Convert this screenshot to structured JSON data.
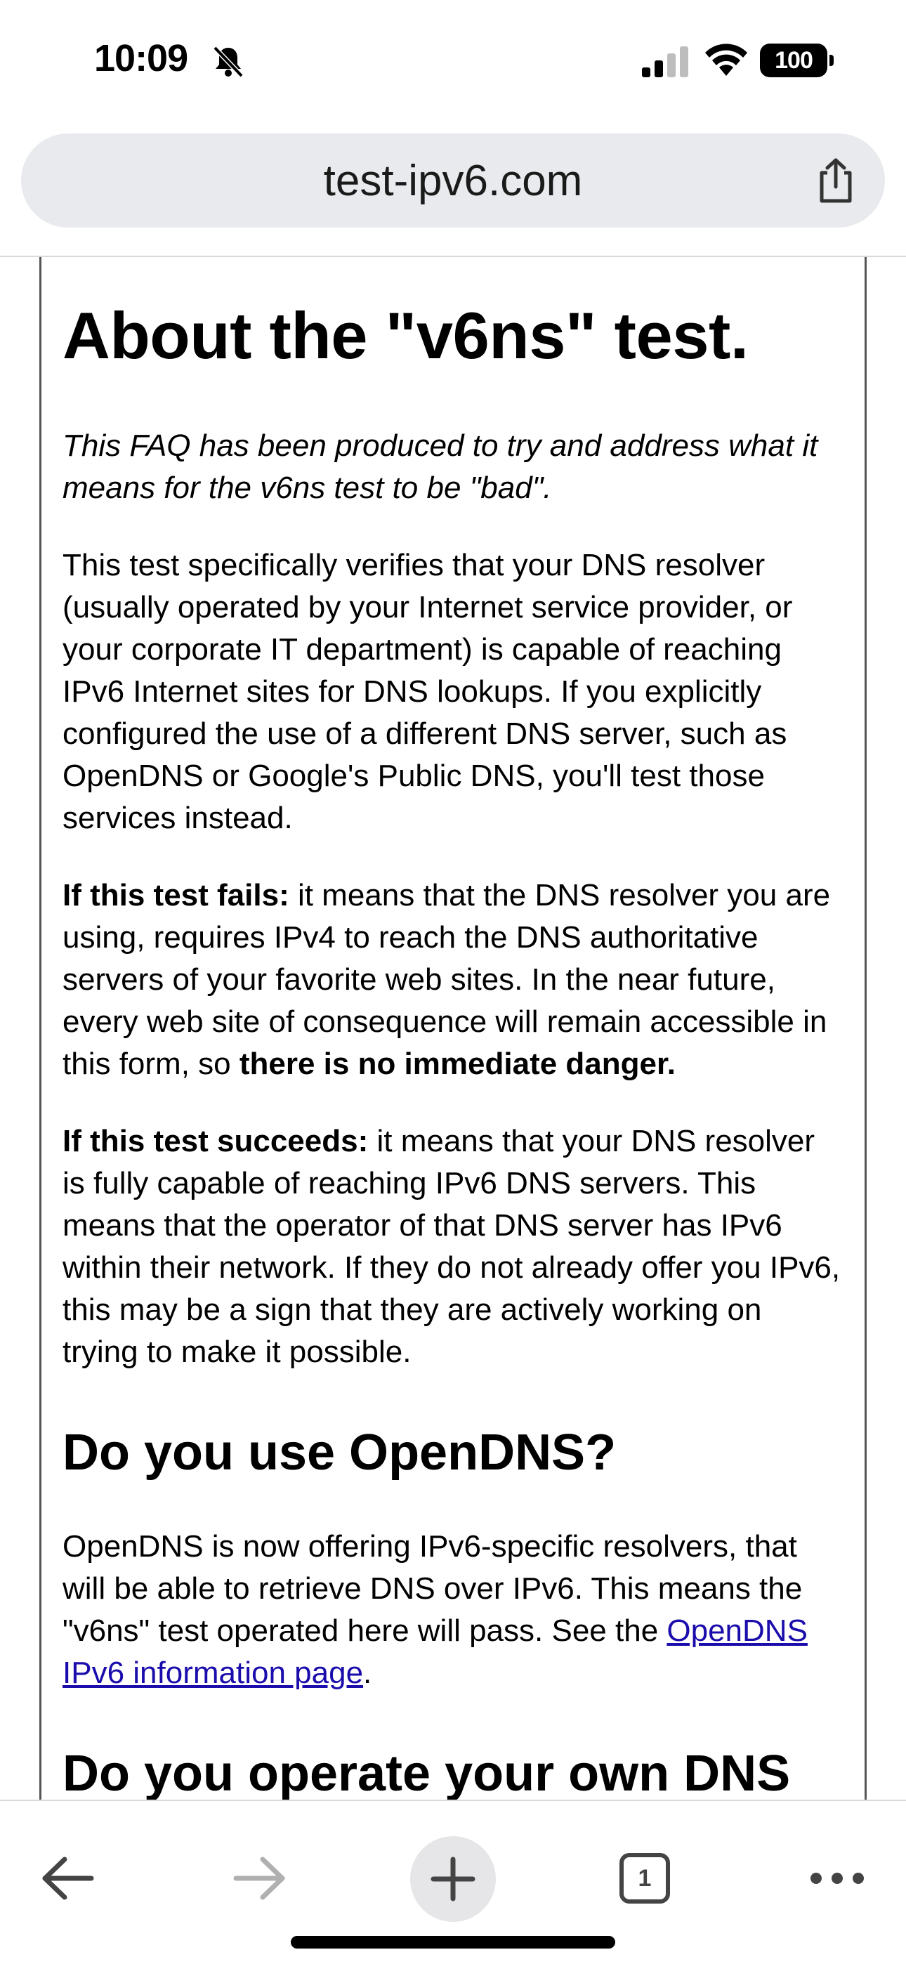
{
  "status_bar": {
    "time": "10:09",
    "battery": "100",
    "icons": [
      "bell-slash-icon",
      "signal-icon",
      "wifi-icon",
      "battery-icon"
    ]
  },
  "url_bar": {
    "domain": "test-ipv6.com",
    "share_icon": "share-icon"
  },
  "article": {
    "title": "About the \"v6ns\" test.",
    "intro": "This FAQ has been produced to try and address what it means for the v6ns test to be \"bad\".",
    "p1": "This test specifically verifies that your DNS resolver (usually operated by your Internet service provider, or your corporate IT department) is capable of reaching IPv6 Internet sites for DNS lookups. If you explicitly configured the use of a different DNS server, such as OpenDNS or Google's Public DNS, you'll test those services instead.",
    "p2_lead": "If this test fails:",
    "p2_text": " it means that the DNS resolver you are using, requires IPv4 to reach the DNS authoritative servers of your favorite web sites. In the near future, every web site of consequence will remain accessible in this form, so ",
    "p2_bold_tail": "there is no immediate danger.",
    "p3_lead": "If this test succeeds:",
    "p3_text": " it means that your DNS resolver is fully capable of reaching IPv6 DNS servers. This means that the operator of that DNS server has IPv6 within their network. If they do not already offer you IPv6, this may be a sign that they are actively working on trying to make it possible.",
    "h2_opendns": "Do you use OpenDNS?",
    "p4_text": "OpenDNS is now offering IPv6-specific resolvers, that will be able to retrieve DNS over IPv6. This means the \"v6ns\" test operated here will pass. See the ",
    "p4_link": "OpenDNS IPv6 information page",
    "p4_end": ".",
    "h2_own_dns": "Do you operate your own DNS"
  },
  "toolbar": {
    "tab_count": "1",
    "icons": [
      "back-arrow-icon",
      "forward-arrow-icon",
      "plus-icon",
      "tabs-icon",
      "more-icon"
    ]
  },
  "colors": {
    "link": "#1a0dab",
    "url_bar_bg": "#e8eaed"
  }
}
